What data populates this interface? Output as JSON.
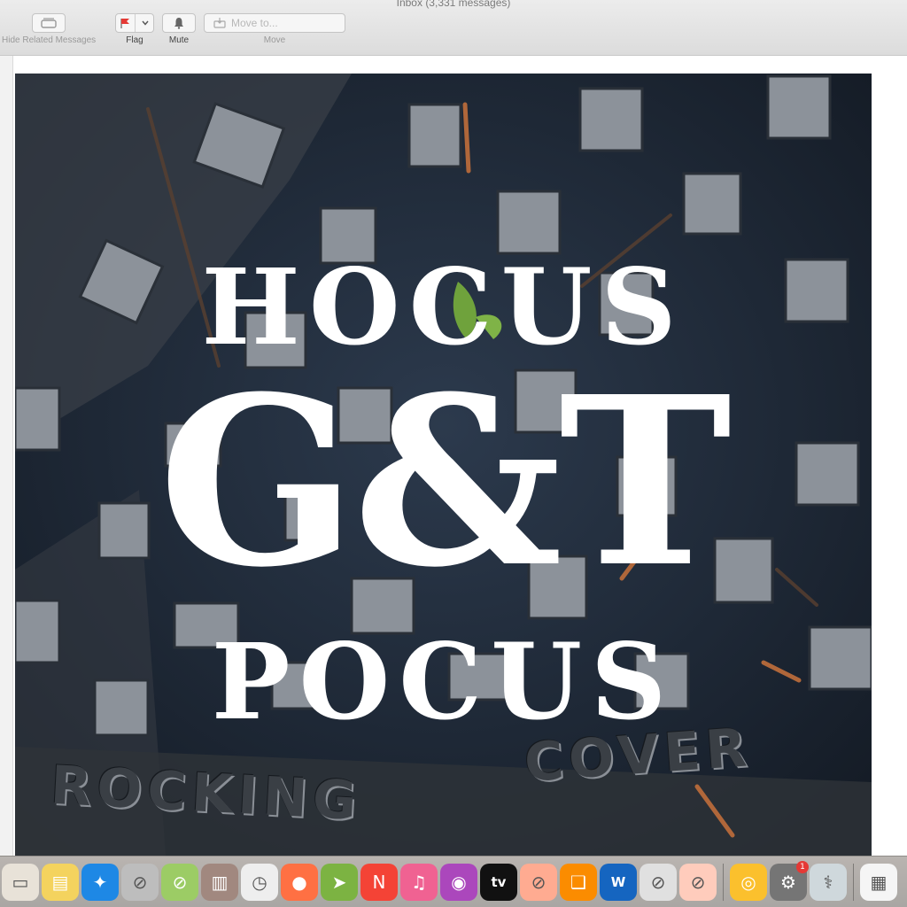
{
  "window": {
    "title": "Inbox (3,331 messages)"
  },
  "toolbar": {
    "hide_related_label": "Hide Related Messages",
    "flag_label": "Flag",
    "mute_label": "Mute",
    "move_placeholder": "Move to...",
    "move_label": "Move",
    "flag_color": "#e53935"
  },
  "artwork": {
    "line1": "HOCUS",
    "line2": "G&T",
    "line3": "POCUS",
    "embossed_left": "ROCKING",
    "embossed_right": "COVER"
  },
  "dock": {
    "items": [
      {
        "name": "finder-partial",
        "icon": "document-icon",
        "color": "#e8e2d8"
      },
      {
        "name": "stickies",
        "icon": "stickies-icon",
        "color": "#f4d35e"
      },
      {
        "name": "safari",
        "icon": "compass-icon",
        "color": "#1e88e5"
      },
      {
        "name": "disabled-app-1",
        "icon": "prohibited-icon",
        "color": "#bdbdbd"
      },
      {
        "name": "disabled-app-2",
        "icon": "prohibited-icon",
        "color": "#9ccc65"
      },
      {
        "name": "notebook-app",
        "icon": "notebook-icon",
        "color": "#a1887f"
      },
      {
        "name": "clock",
        "icon": "clock-icon",
        "color": "#eeeeee"
      },
      {
        "name": "firefox",
        "icon": "firefox-icon",
        "color": "#ff7043"
      },
      {
        "name": "maps",
        "icon": "maps-icon",
        "color": "#7cb342"
      },
      {
        "name": "news",
        "icon": "news-icon",
        "color": "#f44336"
      },
      {
        "name": "music",
        "icon": "music-icon",
        "color": "#f06292"
      },
      {
        "name": "podcasts",
        "icon": "podcasts-icon",
        "color": "#ab47bc"
      },
      {
        "name": "apple-tv",
        "icon": "tv-icon",
        "color": "#111111",
        "text": "tv"
      },
      {
        "name": "disabled-app-3",
        "icon": "prohibited-icon",
        "color": "#ffab91"
      },
      {
        "name": "books",
        "icon": "book-icon",
        "color": "#fb8c00"
      },
      {
        "name": "word",
        "icon": "word-icon",
        "color": "#1565c0",
        "text": "W"
      },
      {
        "name": "disabled-app-4",
        "icon": "prohibited-icon",
        "color": "#e0e0e0"
      },
      {
        "name": "disabled-app-5",
        "icon": "prohibited-icon",
        "color": "#ffccbc"
      },
      {
        "name": "chrome",
        "icon": "chrome-icon",
        "color": "#fbc02d"
      },
      {
        "name": "system-preferences",
        "icon": "gear-icon",
        "color": "#757575",
        "badge": "1"
      },
      {
        "name": "utility-app",
        "icon": "stethoscope-icon",
        "color": "#cfd8dc"
      },
      {
        "name": "screenshot-thumbnail",
        "icon": "image-thumbnail-icon",
        "color": "#f5f5f5"
      }
    ]
  }
}
